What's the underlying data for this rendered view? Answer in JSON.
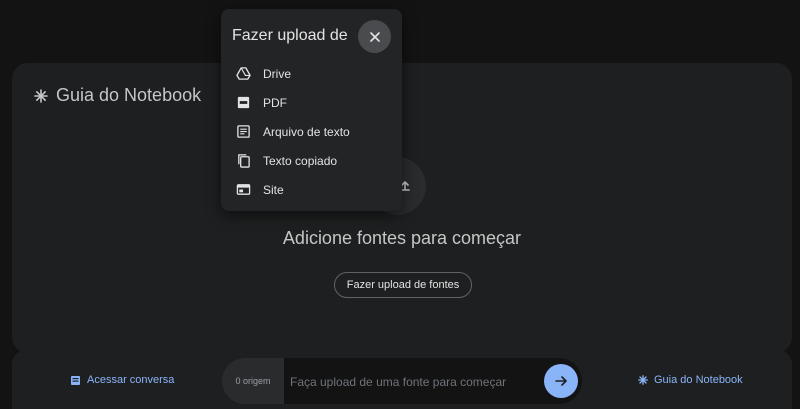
{
  "guide": {
    "title": "Guia do Notebook",
    "empty_message": "Adicione fontes para começar",
    "upload_button": "Fazer upload de fontes"
  },
  "popup": {
    "title": "Fazer upload de",
    "items": [
      {
        "label": "Drive",
        "icon": "drive-icon"
      },
      {
        "label": "PDF",
        "icon": "pdf-icon"
      },
      {
        "label": "Arquivo de texto",
        "icon": "text-file-icon"
      },
      {
        "label": "Texto copiado",
        "icon": "copy-icon"
      },
      {
        "label": "Site",
        "icon": "website-icon"
      }
    ]
  },
  "bottom": {
    "access_chat": "Acessar conversa",
    "source_count": "0 origem",
    "chat_placeholder": "Faça upload de uma fonte para começar",
    "guide_link": "Guia do Notebook"
  },
  "colors": {
    "accent": "#8ab4f8",
    "background": "#131314",
    "card": "#1e1f20"
  }
}
